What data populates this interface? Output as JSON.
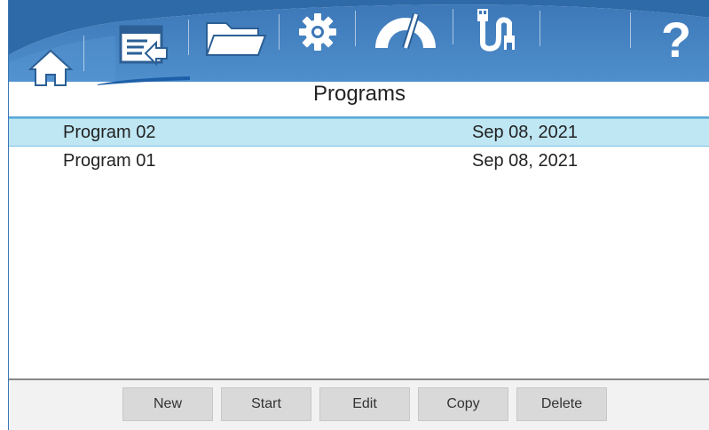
{
  "nav": {
    "items": [
      {
        "icon": "home-icon"
      },
      {
        "icon": "programs-icon"
      },
      {
        "icon": "folder-icon"
      },
      {
        "icon": "settings-gear-icon"
      },
      {
        "icon": "gauge-icon"
      },
      {
        "icon": "usb-cable-icon"
      },
      {
        "icon": "help-icon"
      }
    ],
    "active": "programs",
    "colors": {
      "header_blue": "#3f7fc1",
      "header_light": "#5b9bd5",
      "accent": "#1d5fa8"
    }
  },
  "page_title": "Programs",
  "programs": {
    "rows": [
      {
        "name": "Program 02",
        "date": "Sep 08, 2021",
        "selected": true
      },
      {
        "name": "Program 01",
        "date": "Sep 08, 2021",
        "selected": false
      }
    ],
    "selected_color": "#bfe6f3"
  },
  "toolbar": {
    "new_label": "New",
    "start_label": "Start",
    "edit_label": "Edit",
    "copy_label": "Copy",
    "delete_label": "Delete"
  }
}
